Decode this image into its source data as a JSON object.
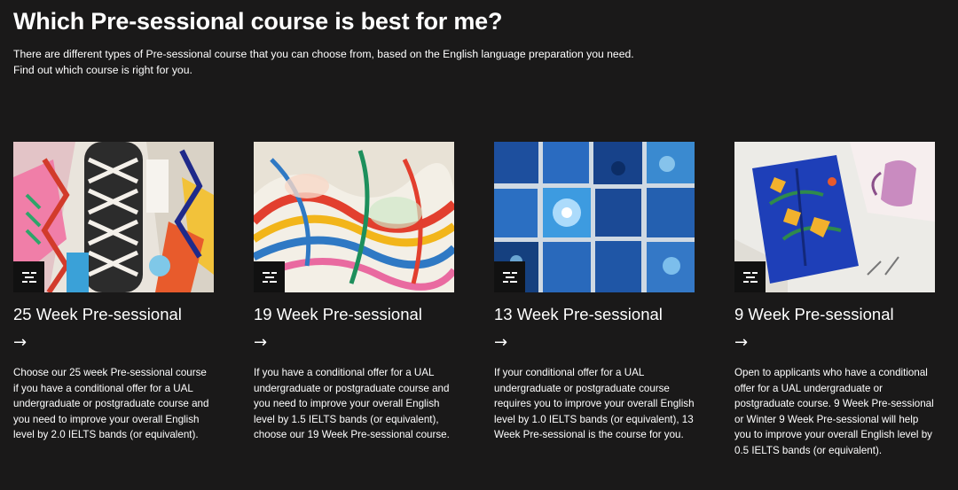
{
  "page": {
    "title": "Which Pre-sessional course is best for me?",
    "intro": "There are different types of Pre-sessional course that you can choose from, based on the English language preparation you need. Find out which course is right for you."
  },
  "cards": [
    {
      "title": "25 Week Pre-sessional",
      "arrow": "→",
      "description": "Choose our 25 week Pre-sessional course if you have a conditional offer for a UAL undergraduate or postgraduate course and you need to improve your overall English level by 2.0 IELTS bands (or equivalent).",
      "image_icon": "gallery-icon"
    },
    {
      "title": "19 Week Pre-sessional",
      "arrow": "→",
      "description": "If you have a conditional offer for a UAL undergraduate or postgraduate course and you need to improve your overall English level by 1.5 IELTS bands (or equivalent), choose our 19 Week Pre-sessional course.",
      "image_icon": "gallery-icon"
    },
    {
      "title": "13 Week Pre-sessional",
      "arrow": "→",
      "description": "If your conditional offer for a UAL undergraduate or postgraduate course requires you to improve your overall English level by 1.0 IELTS bands (or equivalent), 13 Week Pre-sessional is the course for you.",
      "image_icon": "gallery-icon"
    },
    {
      "title": "9 Week Pre-sessional",
      "arrow": "→",
      "description": "Open to applicants who have a conditional offer for a UAL undergraduate or postgraduate course. 9 Week Pre-sessional or Winter 9 Week Pre-sessional will help you to improve your overall English level by 0.5 IELTS bands (or equivalent).",
      "image_icon": "gallery-icon"
    }
  ],
  "colors": {
    "background": "#1a1919",
    "text": "#ffffff",
    "badge": "#111111"
  }
}
